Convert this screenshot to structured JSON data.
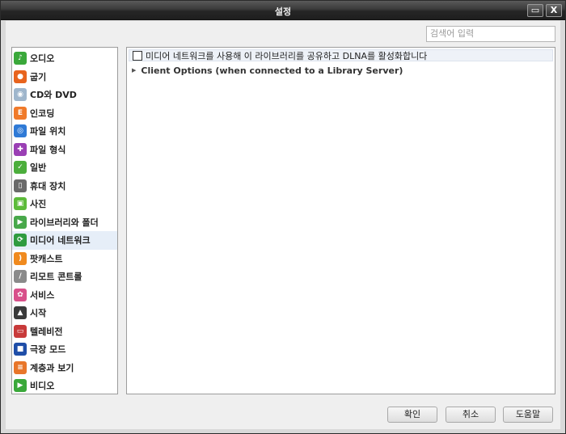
{
  "window": {
    "title": "설정",
    "restore_glyph": "▭",
    "close_glyph": "X"
  },
  "search": {
    "placeholder": "검색어 입력"
  },
  "sidebar": {
    "items": [
      {
        "label": "오디오",
        "icon": "audio-icon",
        "color": "#3aa83a",
        "glyph": "♪"
      },
      {
        "label": "굽기",
        "icon": "burn-icon",
        "color": "#e8641e",
        "glyph": "●"
      },
      {
        "label": "CD와 DVD",
        "icon": "cd-dvd-icon",
        "color": "#9fb6cc",
        "glyph": "◉"
      },
      {
        "label": "인코딩",
        "icon": "encoding-icon",
        "color": "#f07a2a",
        "glyph": "E"
      },
      {
        "label": "파일 위치",
        "icon": "file-location-icon",
        "color": "#2f7ad6",
        "glyph": "◎"
      },
      {
        "label": "파일 형식",
        "icon": "file-format-icon",
        "color": "#9a3fb4",
        "glyph": "✚"
      },
      {
        "label": "일반",
        "icon": "general-icon",
        "color": "#4cae3c",
        "glyph": "✓"
      },
      {
        "label": "휴대 장치",
        "icon": "portable-device-icon",
        "color": "#6a6a6a",
        "glyph": "▯"
      },
      {
        "label": "사진",
        "icon": "photo-icon",
        "color": "#5dbb3a",
        "glyph": "▣"
      },
      {
        "label": "라이브러리와 폴더",
        "icon": "library-folder-icon",
        "color": "#48a84a",
        "glyph": "▶"
      },
      {
        "label": "미디어 네트워크",
        "icon": "media-network-icon",
        "color": "#2f9b3f",
        "glyph": "⟳"
      },
      {
        "label": "팟캐스트",
        "icon": "podcast-icon",
        "color": "#f08a1e",
        "glyph": ")"
      },
      {
        "label": "리모트 콘트롤",
        "icon": "remote-control-icon",
        "color": "#8a8a8a",
        "glyph": "/"
      },
      {
        "label": "서비스",
        "icon": "services-icon",
        "color": "#d8508a",
        "glyph": "✿"
      },
      {
        "label": "시작",
        "icon": "startup-icon",
        "color": "#3a3a3a",
        "glyph": "▲"
      },
      {
        "label": "텔레비전",
        "icon": "television-icon",
        "color": "#c83a3a",
        "glyph": "▭"
      },
      {
        "label": "극장 모드",
        "icon": "theater-mode-icon",
        "color": "#1f4ea8",
        "glyph": "■"
      },
      {
        "label": "계층과 보기",
        "icon": "tree-view-icon",
        "color": "#e8762a",
        "glyph": "≡"
      },
      {
        "label": "비디오",
        "icon": "video-icon",
        "color": "#3aa83a",
        "glyph": "▶"
      }
    ],
    "selected_index": 10
  },
  "panel": {
    "dlna_checkbox_label": "미디어 네트워크를 사용해 이 라이브러리를 공유하고 DLNA를 활성화합니다",
    "dlna_checked": false,
    "client_options_label": "Client Options (when connected to a Library Server)",
    "expander_glyph": "▶"
  },
  "buttons": {
    "ok": "확인",
    "cancel": "취소",
    "help": "도움말"
  }
}
